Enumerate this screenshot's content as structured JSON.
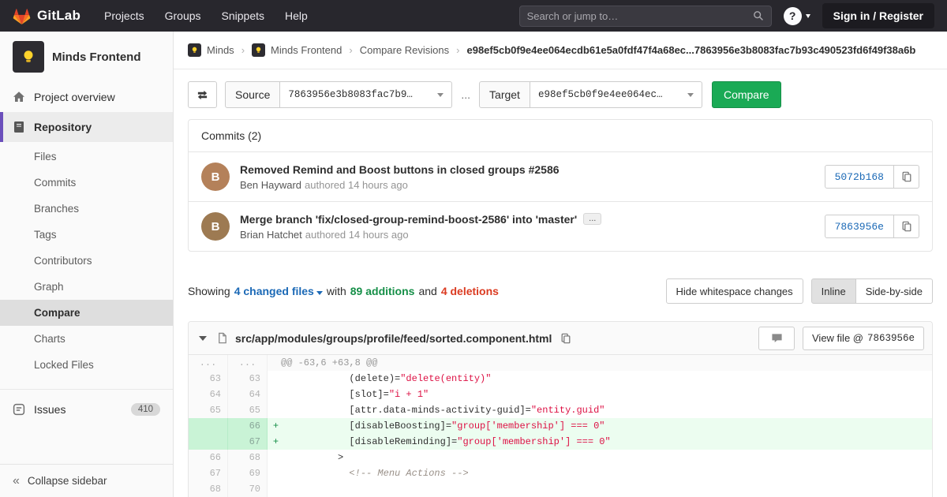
{
  "navbar": {
    "brand": "GitLab",
    "links": [
      "Projects",
      "Groups",
      "Snippets",
      "Help"
    ],
    "search_placeholder": "Search or jump to…",
    "help_glyph": "?",
    "signin_label": "Sign in / Register"
  },
  "sidebar": {
    "project_title": "Minds Frontend",
    "overview_label": "Project overview",
    "repository_label": "Repository",
    "repo_items": [
      "Files",
      "Commits",
      "Branches",
      "Tags",
      "Contributors",
      "Graph",
      "Compare",
      "Charts",
      "Locked Files"
    ],
    "active_repo_item": "Compare",
    "issues_label": "Issues",
    "issues_count": "410",
    "collapse_label": "Collapse sidebar",
    "collapse_glyph": "«"
  },
  "breadcrumb": {
    "group": "Minds",
    "project": "Minds Frontend",
    "section": "Compare Revisions",
    "separator": "›",
    "current": "e98ef5cb0f9e4ee064ecdb61e5a0fdf47f4a68ec...7863956e3b8083fac7b93c490523fd6f49f38a6b"
  },
  "compare_form": {
    "source_label": "Source",
    "source_value": "7863956e3b8083fac7b9…",
    "between": "...",
    "target_label": "Target",
    "target_value": "e98ef5cb0f9e4ee064ec…",
    "compare_label": "Compare"
  },
  "commits": {
    "heading": "Commits (2)",
    "expander_glyph": "...",
    "items": [
      {
        "title": "Removed Remind and Boost buttons in closed groups #2586",
        "author": "Ben Hayward",
        "meta": "authored 14 hours ago",
        "sha": "5072b168",
        "initial": "B",
        "avatar_color": "#b4815a",
        "expander": false
      },
      {
        "title": "Merge branch 'fix/closed-group-remind-boost-2586' into 'master'",
        "author": "Brian Hatchet",
        "meta": "authored 14 hours ago",
        "sha": "7863956e",
        "initial": "B",
        "avatar_color": "#9d7a52",
        "expander": true
      }
    ]
  },
  "summary": {
    "showing": "Showing",
    "files": "4 changed files",
    "with": "with",
    "additions": "89 additions",
    "and": "and",
    "deletions": "4 deletions",
    "hide_whitespace": "Hide whitespace changes",
    "inline": "Inline",
    "side_by_side": "Side-by-side"
  },
  "diff": {
    "path": "src/app/modules/groups/profile/feed/sorted.component.html",
    "view_file_label": "View file @",
    "view_file_sha": "7863956e",
    "lines": [
      {
        "old": "...",
        "new": "...",
        "type": "meta",
        "segments": [
          {
            "text": "@@ -63,6 +63,8 @@",
            "cls": "m"
          }
        ]
      },
      {
        "old": "63",
        "new": "63",
        "type": "ctx",
        "segments": [
          {
            "text": "            (delete)=",
            "cls": "p"
          },
          {
            "text": "\"delete(entity)\"",
            "cls": "s"
          }
        ]
      },
      {
        "old": "64",
        "new": "64",
        "type": "ctx",
        "segments": [
          {
            "text": "            [slot]=",
            "cls": "p"
          },
          {
            "text": "\"i + 1\"",
            "cls": "s"
          }
        ]
      },
      {
        "old": "65",
        "new": "65",
        "type": "ctx",
        "segments": [
          {
            "text": "            [attr.data-minds-activity-guid]=",
            "cls": "p"
          },
          {
            "text": "\"entity.guid\"",
            "cls": "s"
          }
        ]
      },
      {
        "old": "",
        "new": "66",
        "type": "add",
        "segments": [
          {
            "text": "            [disableBoosting]=",
            "cls": "p"
          },
          {
            "text": "\"group['membership'] === 0\"",
            "cls": "s"
          }
        ]
      },
      {
        "old": "",
        "new": "67",
        "type": "add",
        "segments": [
          {
            "text": "            [disableReminding]=",
            "cls": "p"
          },
          {
            "text": "\"group['membership'] === 0\"",
            "cls": "s"
          }
        ]
      },
      {
        "old": "66",
        "new": "68",
        "type": "ctx",
        "segments": [
          {
            "text": "          >",
            "cls": "p"
          }
        ]
      },
      {
        "old": "67",
        "new": "69",
        "type": "ctx",
        "segments": [
          {
            "text": "            <!-- Menu Actions -->",
            "cls": "c"
          }
        ]
      },
      {
        "old": "68",
        "new": "70",
        "type": "ctx",
        "segments": [
          {
            "text": "",
            "cls": "p"
          }
        ]
      }
    ]
  },
  "colors": {
    "accent_purple": "#6b4fbb",
    "green": "#1aaa55",
    "link_blue": "#1b69b6",
    "addition_green": "#168f48",
    "deletion_red": "#db3b21",
    "added_line_bg": "#ecfdf0"
  }
}
